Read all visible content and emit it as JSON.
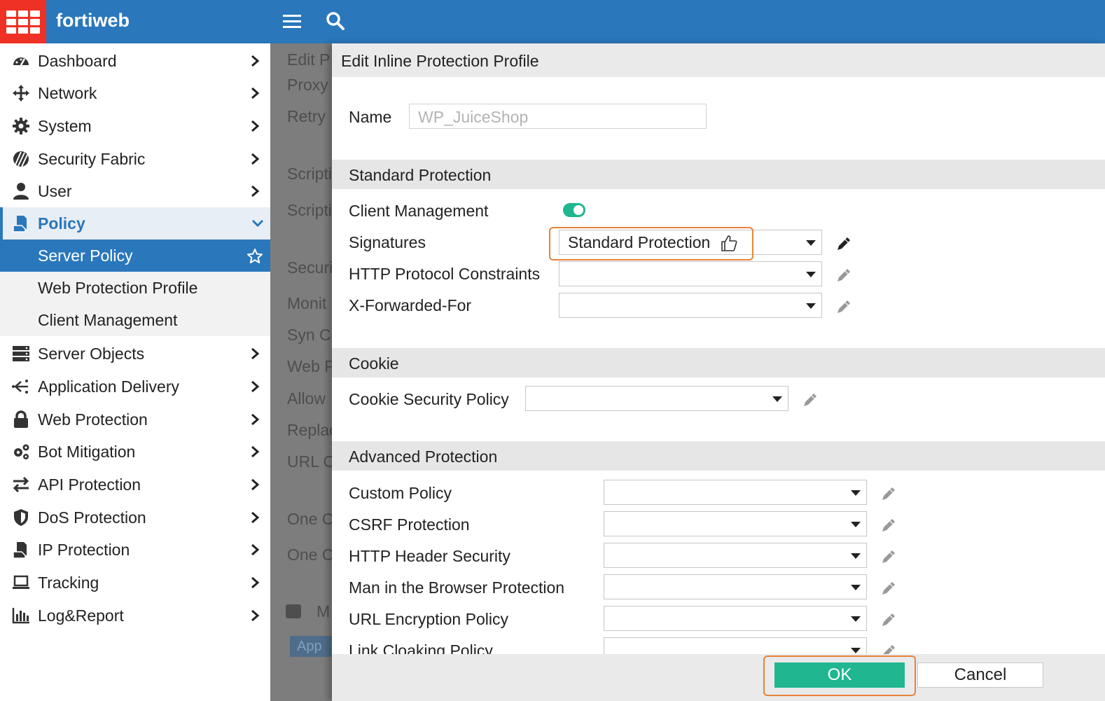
{
  "app": {
    "brand": "fortiweb"
  },
  "sidebar": {
    "items": [
      {
        "label": "Dashboard",
        "icon": "dashboard-icon"
      },
      {
        "label": "Network",
        "icon": "network-icon"
      },
      {
        "label": "System",
        "icon": "gear-icon"
      },
      {
        "label": "Security Fabric",
        "icon": "security-fabric-icon"
      },
      {
        "label": "User",
        "icon": "user-icon"
      },
      {
        "label": "Policy",
        "icon": "policy-icon"
      },
      {
        "label": "Server Objects",
        "icon": "server-icon"
      },
      {
        "label": "Application Delivery",
        "icon": "app-delivery-icon"
      },
      {
        "label": "Web Protection",
        "icon": "lock-icon"
      },
      {
        "label": "Bot Mitigation",
        "icon": "bot-icon"
      },
      {
        "label": "API Protection",
        "icon": "api-icon"
      },
      {
        "label": "DoS Protection",
        "icon": "shield-icon"
      },
      {
        "label": "IP Protection",
        "icon": "ip-icon"
      },
      {
        "label": "Tracking",
        "icon": "laptop-icon"
      },
      {
        "label": "Log&Report",
        "icon": "chart-icon"
      }
    ],
    "policy_sub": [
      {
        "label": "Server Policy"
      },
      {
        "label": "Web Protection Profile"
      },
      {
        "label": "Client Management"
      }
    ]
  },
  "background": {
    "labels": [
      "Edit P",
      "Proxy",
      "Retry",
      "Scripti",
      "Scripti",
      "Securi",
      "Monit",
      "Syn C",
      "Web P",
      "Allow",
      "Replac",
      "URL C",
      "One C",
      "One C",
      "M"
    ],
    "button": "App"
  },
  "dialog": {
    "title": "Edit Inline Protection Profile",
    "name_label": "Name",
    "name_value": "WP_JuiceShop",
    "standard": {
      "heading": "Standard Protection",
      "client_management": "Client Management",
      "signatures": "Signatures",
      "signatures_value": "Standard Protection",
      "http_protocol": "HTTP Protocol Constraints",
      "x_forwarded": "X-Forwarded-For"
    },
    "cookie": {
      "heading": "Cookie",
      "policy": "Cookie Security Policy"
    },
    "advanced": {
      "heading": "Advanced Protection",
      "custom": "Custom Policy",
      "csrf": "CSRF Protection",
      "http_header": "HTTP Header Security",
      "mitb": "Man in the Browser Protection",
      "url_enc": "URL Encryption Policy",
      "link_cloak": "Link Cloaking Policy"
    },
    "ok": "OK",
    "cancel": "Cancel"
  },
  "colors": {
    "topbar": "#2a77bc",
    "logo": "#ee3124",
    "accent": "#1fb690",
    "highlight": "#e8833a"
  }
}
